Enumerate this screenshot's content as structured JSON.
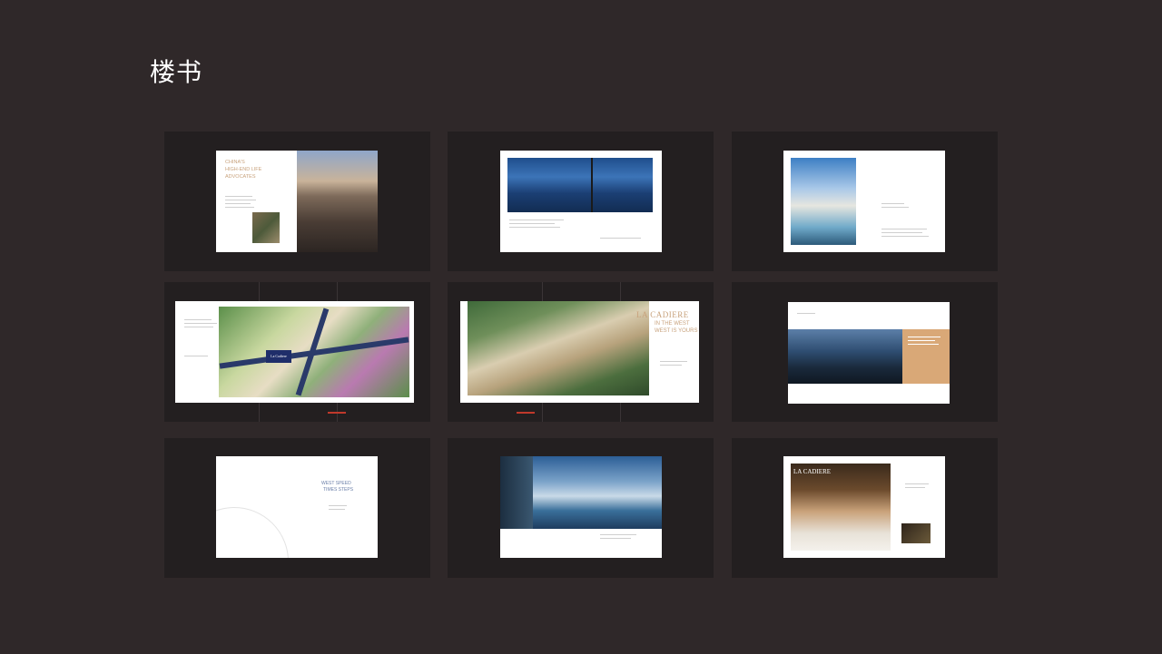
{
  "page": {
    "title": "楼书"
  },
  "spreads": [
    {
      "id": 1,
      "headline": [
        "CHINA'S",
        "HIGH-END LIFE",
        "ADVOCATES"
      ]
    },
    {
      "id": 2
    },
    {
      "id": 3
    },
    {
      "id": 4,
      "map_logo": "La Cadiere"
    },
    {
      "id": 5,
      "brand": "LA CADIERE",
      "headline": [
        "IN THE WEST",
        "WEST IS YOURS"
      ]
    },
    {
      "id": 6
    },
    {
      "id": 7,
      "headline": [
        "WEST SPEED",
        "TIMES STEPS"
      ]
    },
    {
      "id": 8
    },
    {
      "id": 9,
      "brand": "LA CADIERE"
    }
  ],
  "colors": {
    "background": "#2f2829",
    "panel": "#231f20",
    "accent": "#c8a27c",
    "sheet": "#ffffff"
  }
}
